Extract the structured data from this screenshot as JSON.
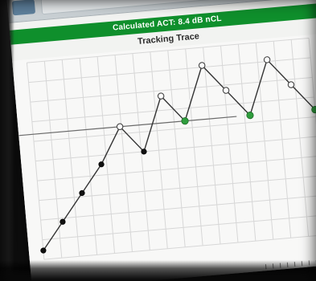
{
  "header": {
    "calculated_label": "Calculated ACT: 8.4 dB nCL",
    "tab_label": "",
    "pager_label": "◂ ▸"
  },
  "chart_title": "Tracking Trace",
  "chart_data": {
    "type": "line",
    "title": "Tracking Trace",
    "series": [
      {
        "name": "",
        "points": [
          {
            "x": 0,
            "y": 2
          },
          {
            "x": 1,
            "y": 8
          },
          {
            "x": 2,
            "y": 14
          },
          {
            "x": 3,
            "y": 20
          },
          {
            "x": 4,
            "y": 28
          },
          {
            "x": 5,
            "y": 22
          },
          {
            "x": 6,
            "y": 34
          },
          {
            "x": 7,
            "y": 28
          },
          {
            "x": 8,
            "y": 40
          },
          {
            "x": 9,
            "y": 34
          },
          {
            "x": 10,
            "y": 28
          },
          {
            "x": 11,
            "y": 40
          },
          {
            "x": 12,
            "y": 34
          },
          {
            "x": 13,
            "y": 28
          }
        ],
        "filled_black_indices": [
          0,
          1,
          2,
          3,
          5
        ],
        "open_white_indices": [
          4,
          6,
          8,
          9,
          11,
          12
        ],
        "green_indices": [
          7,
          10,
          13
        ]
      }
    ],
    "reference_line_y": 28,
    "colors": {
      "green": "#2f9d3d",
      "black": "#111111",
      "open": "#ffffff",
      "grid": "#d7d7d7",
      "axis": "#6a6a6a"
    }
  }
}
